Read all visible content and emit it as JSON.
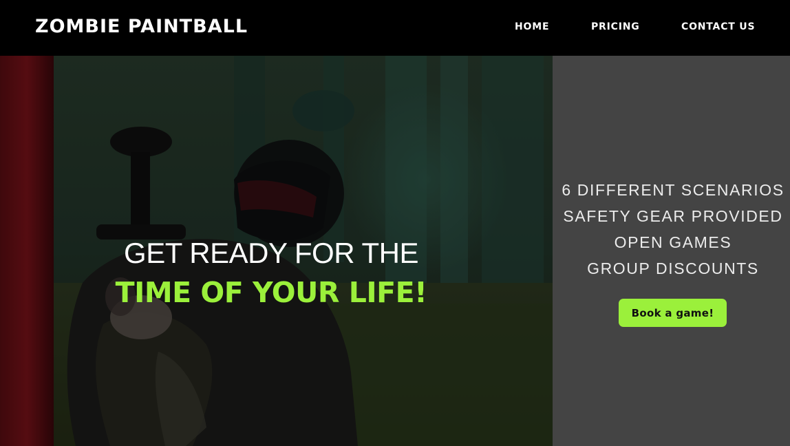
{
  "header": {
    "brand": "ZOMBIE PAINTBALL",
    "nav": [
      {
        "label": "HOME"
      },
      {
        "label": "PRICING"
      },
      {
        "label": "CONTACT US"
      }
    ]
  },
  "hero": {
    "line1": "GET READY FOR THE",
    "line2": "TIME OF YOUR LIFE!",
    "image": "paintball player in mask aiming marker behind red bunker"
  },
  "features": {
    "items": [
      "6 DIFFERENT SCENARIOS",
      "SAFETY GEAR PROVIDED",
      "OPEN GAMES",
      "GROUP DISCOUNTS"
    ],
    "cta": "Book a game!"
  },
  "colors": {
    "accent": "#9bf03b",
    "header_bg": "#000000",
    "side_panel_bg": "#444444",
    "text_light": "#ffffff"
  }
}
